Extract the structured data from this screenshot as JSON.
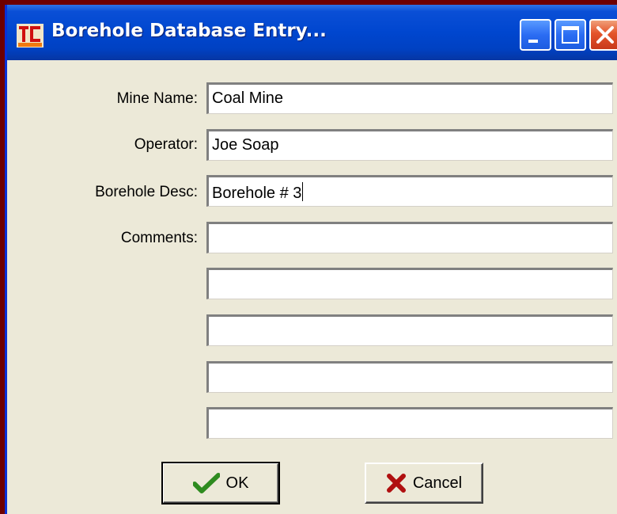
{
  "window": {
    "title": "Borehole Database Entry..."
  },
  "form": {
    "mine_name": {
      "label": "Mine Name:",
      "value": "Coal Mine"
    },
    "operator": {
      "label": "Operator:",
      "value": "Joe Soap"
    },
    "borehole_desc": {
      "label": "Borehole Desc:",
      "value": "Borehole # 3"
    },
    "comments": {
      "label": "Comments:",
      "lines": [
        "",
        "",
        "",
        "",
        ""
      ]
    }
  },
  "buttons": {
    "ok": {
      "label": "OK",
      "icon": "checkmark-icon"
    },
    "cancel": {
      "label": "Cancel",
      "icon": "x-icon"
    }
  },
  "colors": {
    "titlebar": "#0046cf",
    "dialog_bg": "#ece9d8",
    "close_button": "#e4542a",
    "ok_check": "#2e8b1f",
    "cancel_x": "#b01010",
    "desktop": "#6e0000"
  }
}
